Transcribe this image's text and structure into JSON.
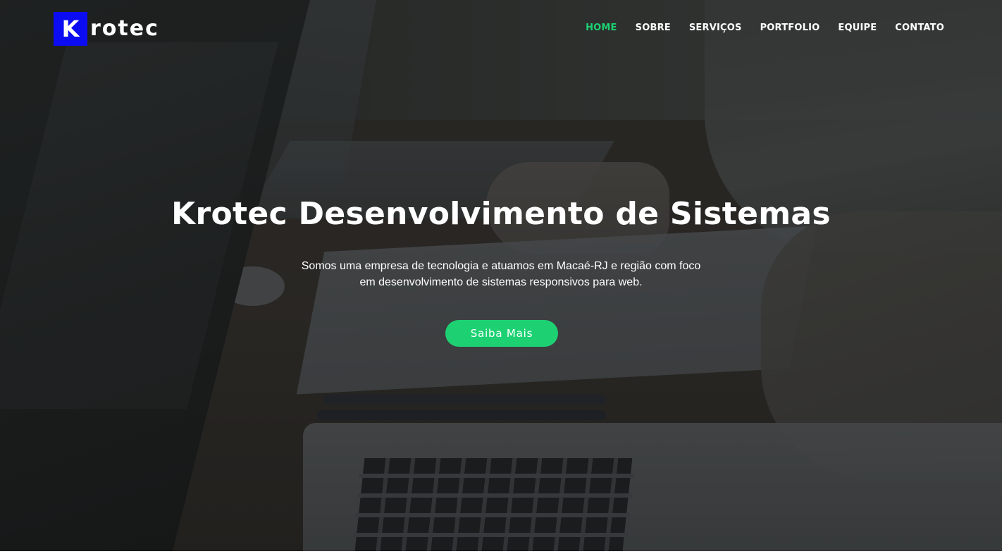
{
  "brand": {
    "logo_letter": "K",
    "logo_rest": "rotec",
    "logo_color": "#0c0cf2"
  },
  "nav": {
    "items": [
      {
        "label": "HOME",
        "active": true
      },
      {
        "label": "SOBRE",
        "active": false
      },
      {
        "label": "SERVIÇOS",
        "active": false
      },
      {
        "label": "PORTFOLIO",
        "active": false
      },
      {
        "label": "EQUIPE",
        "active": false
      },
      {
        "label": "CONTATO",
        "active": false
      }
    ],
    "active_color": "#1dd173"
  },
  "hero": {
    "title": "Krotec Desenvolvimento de Sistemas",
    "text_line1": "Somos uma empresa de tecnologia e atuamos em Macaé-RJ e região com foco",
    "text_line2": "em desenvolvimento de sistemas responsivos para web.",
    "cta_label": "Saiba Mais",
    "cta_color": "#1dd173"
  }
}
